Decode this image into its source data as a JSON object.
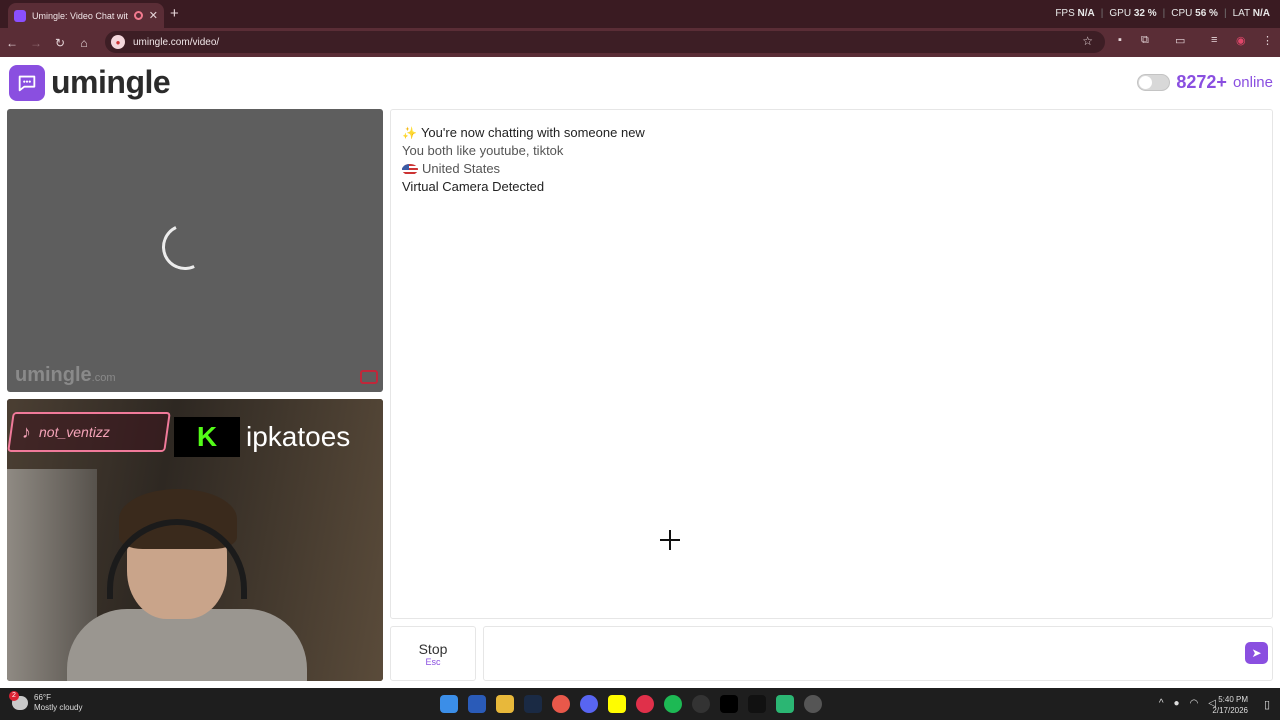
{
  "browser": {
    "tab_title": "Umingle: Video Chat with S",
    "new_tab": "+",
    "url": "umingle.com/video/",
    "stats": [
      {
        "label": "FPS",
        "value": "N/A"
      },
      {
        "label": "GPU",
        "value": "32 %"
      },
      {
        "label": "CPU",
        "value": "56 %"
      },
      {
        "label": "LAT",
        "value": "N/A"
      }
    ]
  },
  "header": {
    "logo_text": "umingle",
    "online_count": "8272+",
    "online_label": "online"
  },
  "remote_video": {
    "watermark": "umingle",
    "watermark_suffix": ".com"
  },
  "local_video": {
    "tiktok_name": "not_ventizz",
    "kick_logo": "K",
    "kick_name": "ipkatoes"
  },
  "chat": {
    "messages": [
      "You're now chatting with someone new",
      "You both like youtube, tiktok",
      "United States",
      "Virtual Camera Detected"
    ],
    "stop_label": "Stop",
    "stop_shortcut": "Esc",
    "input_placeholder": ""
  },
  "taskbar": {
    "weather_temp": "66°F",
    "weather_desc": "Mostly cloudy",
    "weather_badge": "2",
    "time": "5:40 PM",
    "date": "2/17/2026"
  },
  "colors": {
    "brand": "#8a4fe0",
    "chrome_dark": "#3a1b22",
    "chrome": "#5a2d36"
  }
}
